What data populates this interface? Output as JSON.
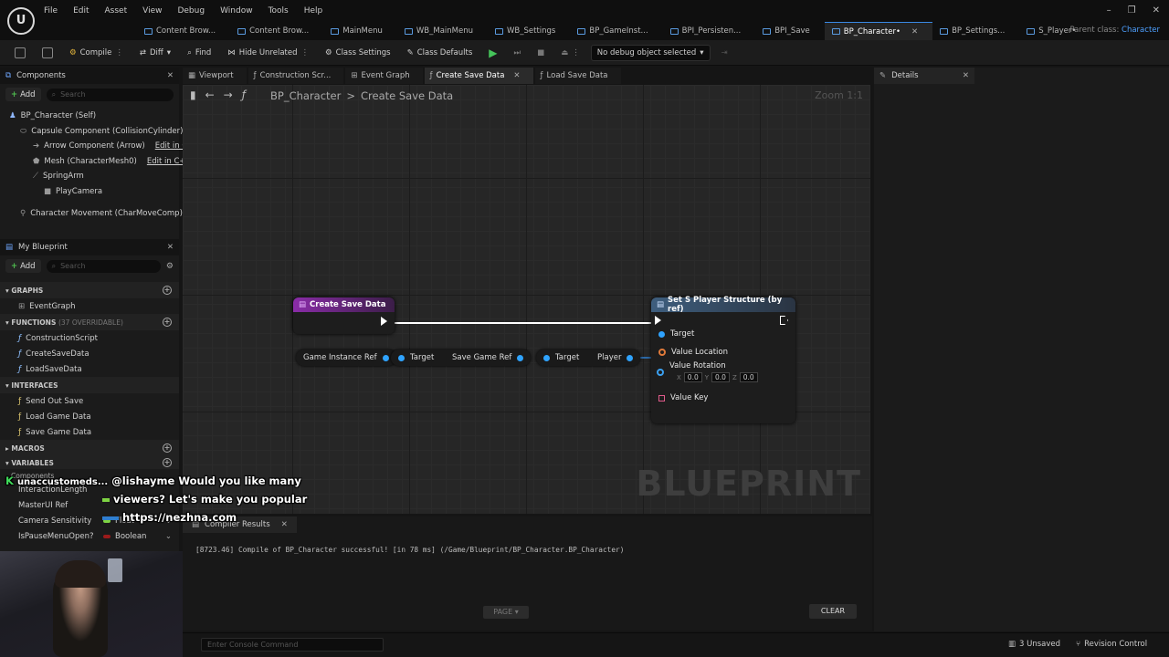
{
  "app": {
    "menu": [
      "File",
      "Edit",
      "Asset",
      "View",
      "Debug",
      "Window",
      "Tools",
      "Help"
    ],
    "tabs": [
      "Content Brow...",
      "Content Brow...",
      "MainMenu",
      "WB_MainMenu",
      "WB_Settings",
      "BP_GameInst...",
      "BPI_Persisten...",
      "BPI_Save",
      "BP_Character•",
      "BP_Settings...",
      "S_Player•"
    ],
    "active_tab_index": 8,
    "parent_class_label": "Parent class:",
    "parent_class_value": "Character"
  },
  "toolbar": {
    "compile": "Compile",
    "diff": "Diff",
    "find": "Find",
    "hide_unrelated": "Hide Unrelated",
    "class_settings": "Class Settings",
    "class_defaults": "Class Defaults",
    "debug_object": "No debug object selected"
  },
  "components": {
    "title": "Components",
    "add": "Add",
    "search_placeholder": "Search",
    "edit_cpp": "Edit in C++",
    "items": [
      "BP_Character (Self)",
      "Capsule Component (CollisionCylinder)",
      "Arrow Component (Arrow)",
      "Mesh (CharacterMesh0)",
      "SpringArm",
      "PlayCamera",
      "Character Movement (CharMoveComp)"
    ]
  },
  "my_blueprint": {
    "title": "My Blueprint",
    "add": "Add",
    "search_placeholder": "Search",
    "graphs_label": "GRAPHS",
    "graphs": [
      "EventGraph"
    ],
    "functions_label": "FUNCTIONS",
    "functions_sub": "(37 OVERRIDABLE)",
    "functions": [
      "ConstructionScript",
      "CreateSaveData",
      "LoadSaveData"
    ],
    "interfaces_label": "INTERFACES",
    "interfaces": [
      "Send Out Save",
      "Load Game Data",
      "Save Game Data"
    ],
    "macros_label": "MACROS",
    "variables_label": "VARIABLES",
    "components_label": "Components",
    "variables": [
      {
        "name": "InteractionLength",
        "type": ""
      },
      {
        "name": "MasterUI Ref",
        "type": ""
      },
      {
        "name": "Camera Sensitivity",
        "type": "Float"
      },
      {
        "name": "IsPauseMenuOpen?",
        "type": "Boolean"
      }
    ]
  },
  "graph_tabs": [
    {
      "label": "Viewport",
      "active": false
    },
    {
      "label": "Construction Scr...",
      "active": false
    },
    {
      "label": "Event Graph",
      "active": false
    },
    {
      "label": "Create Save Data",
      "active": true
    },
    {
      "label": "Load Save Data",
      "active": false
    }
  ],
  "graph": {
    "breadcrumb_root": "BP_Character",
    "breadcrumb_current": "Create Save Data",
    "zoom": "Zoom 1:1",
    "watermark": "BLUEPRINT",
    "entry_node": "Create Save Data",
    "var_game_instance": "Game Instance Ref",
    "var_target": "Target",
    "var_save_game_ref": "Save Game Ref",
    "var_target2": "Target",
    "var_player": "Player",
    "set_node": {
      "title": "Set S Player Structure (by ref)",
      "target": "Target",
      "value_location": "Value Location",
      "value_rotation": "Value Rotation",
      "rot_x": "0.0",
      "rot_y": "0.0",
      "rot_z": "0.0",
      "x_label": "X",
      "y_label": "Y",
      "z_label": "Z",
      "value_key": "Value Key"
    }
  },
  "compiler": {
    "tab": "Compiler Results",
    "message": "[8723.46] Compile of BP_Character successful! [in 78 ms] (/Game/Blueprint/BP_Character.BP_Character)",
    "page_btn": "PAGE",
    "clear_btn": "CLEAR"
  },
  "details": {
    "title": "Details"
  },
  "status": {
    "console_placeholder": "Enter Console Command",
    "unsaved": "3 Unsaved",
    "revision": "Revision Control"
  },
  "chat": {
    "user": "unaccustomeds...",
    "line1": "@lishayme Would you like many",
    "line2": "viewers? Let's make you popular",
    "line3": "https://nezhna.com"
  }
}
